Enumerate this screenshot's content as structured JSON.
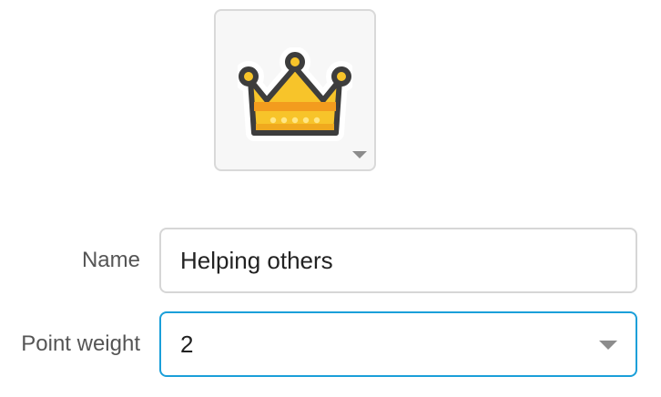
{
  "icon_picker": {
    "selected_icon": "crown-icon",
    "colors": {
      "outline": "#3d3d3d",
      "gold": "#f7c42a",
      "gold_band": "#f39c1e",
      "jewels": "#ffe685"
    }
  },
  "form": {
    "name": {
      "label": "Name",
      "value": "Helping others"
    },
    "point_weight": {
      "label": "Point weight",
      "value": "2"
    }
  },
  "colors": {
    "focus_border": "#1a9fd9",
    "input_border": "#d6d6d6",
    "label_text": "#555555"
  }
}
